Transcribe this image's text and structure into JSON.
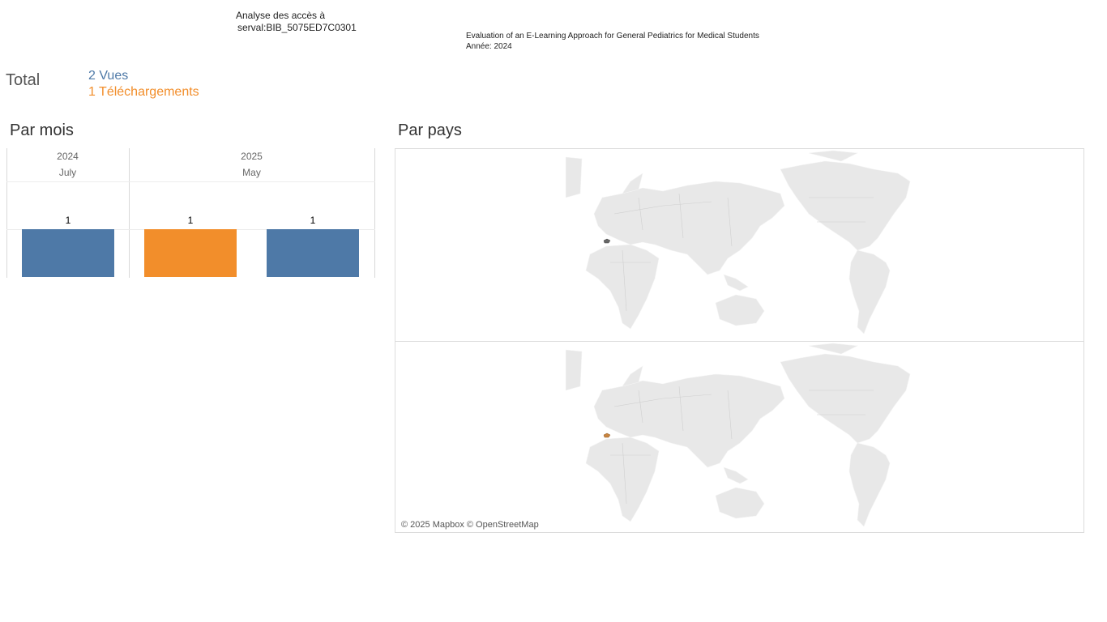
{
  "header": {
    "analyse_line1": "Analyse des accès à",
    "analyse_line2": "serval:BIB_5075ED7C0301",
    "publication_title": "Evaluation of an E-Learning Approach for General Pediatrics for Medical Students",
    "publication_year": "Année: 2024"
  },
  "totals": {
    "label": "Total",
    "vues": "2 Vues",
    "telechargements": "1 Téléchargements"
  },
  "sections": {
    "par_mois": "Par mois",
    "par_pays": "Par pays"
  },
  "colors": {
    "vues": "#4e79a7",
    "telechargements": "#f28e2b",
    "land": "#e8e8e8",
    "border": "#cfcfcf"
  },
  "chart_data": {
    "type": "bar",
    "groups": [
      {
        "year": "2024",
        "month": "July",
        "bars": [
          {
            "series": "Vues",
            "value": 1
          }
        ]
      },
      {
        "year": "2025",
        "month": "May",
        "bars": [
          {
            "series": "Téléchargements",
            "value": 1
          },
          {
            "series": "Vues",
            "value": 1
          }
        ]
      }
    ],
    "value_labels": [
      "1",
      "1",
      "1"
    ],
    "ylim": [
      0,
      1
    ]
  },
  "map": {
    "attribution": "© 2025 Mapbox © OpenStreetMap",
    "panels": [
      {
        "series": "Vues",
        "highlight_country": "Switzerland"
      },
      {
        "series": "Téléchargements",
        "highlight_country": "Switzerland"
      }
    ]
  }
}
